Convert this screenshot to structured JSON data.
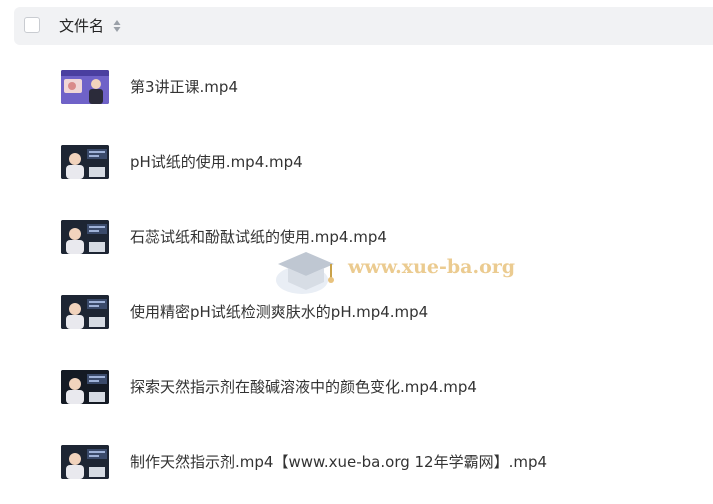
{
  "header": {
    "title": "文件名"
  },
  "files": [
    {
      "name": "第3讲正课.mp4",
      "thumb_style": "lecture"
    },
    {
      "name": "pH试纸的使用.mp4.mp4",
      "thumb_style": "teacher"
    },
    {
      "name": "石蕊试纸和酚酞试纸的使用.mp4.mp4",
      "thumb_style": "teacher"
    },
    {
      "name": "使用精密pH试纸检测爽肤水的pH.mp4.mp4",
      "thumb_style": "teacher"
    },
    {
      "name": "探索天然指示剂在酸碱溶液中的颜色变化.mp4.mp4",
      "thumb_style": "teacher-dark"
    },
    {
      "name": "制作天然指示剂.mp4【www.xue-ba.org 12年学霸网】.mp4",
      "thumb_style": "teacher"
    }
  ],
  "watermark": {
    "text": "www.xue-ba.org"
  }
}
